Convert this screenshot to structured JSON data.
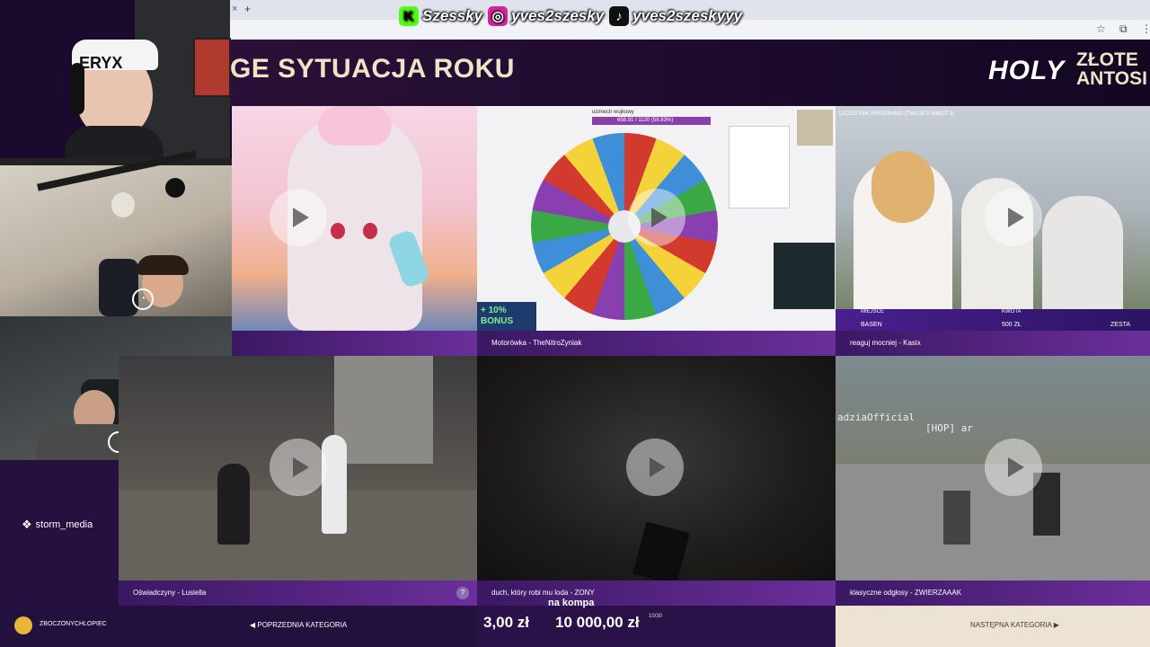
{
  "browser": {
    "tab_close": "×",
    "tab_new": "+",
    "star_icon": "☆",
    "ext_icon": "⧉",
    "menu_icon": "⋮"
  },
  "socials": [
    {
      "platform": "kick",
      "glyph": "K",
      "handle": "Szessky",
      "color": "#53fc18"
    },
    {
      "platform": "instagram",
      "glyph": "◎",
      "handle": "yves2szesky",
      "color": "#d6249f"
    },
    {
      "platform": "tiktok",
      "glyph": "♪",
      "handle": "yves2szeskyyy",
      "color": "#111111"
    }
  ],
  "header": {
    "title": "GE SYTUACJA ROKU",
    "logo_holy": "HOLY",
    "logo_line1": "ZŁOTE",
    "logo_line2": "ANTOSI"
  },
  "webcams": {
    "cam1_headband": "ERYX"
  },
  "sidebar": {
    "brand": "storm_media"
  },
  "tiles": [
    {
      "caption": "",
      "col": 1,
      "row": 1
    },
    {
      "caption": "Motorówka - TheNitroZyniak",
      "col": 2,
      "row": 1,
      "wheel_title": "uśmiech wujkowy",
      "wheel_progress": "658.91 / 1120 (58.83%)",
      "bonus": "+ 10% BONUS"
    },
    {
      "caption": "reaguj mocniej - Kasix",
      "col": 3,
      "row": 1,
      "top_label": "UCZESTNIK PROGRAMU (TWOJE 5 MINUT 3)",
      "lower_labels": [
        "MIEJSCE",
        "KWOTA",
        "BASEN",
        "500 ZŁ",
        "ZESTA"
      ]
    },
    {
      "caption": "Oświadczyny - Lusiella",
      "col": 1,
      "row": 2,
      "help": "?"
    },
    {
      "caption": "duch, który robi mu loda - ZONY",
      "col": 2,
      "row": 2
    },
    {
      "caption": "klasyczne odgłosy - ZWIERZAAAK",
      "col": 3,
      "row": 2,
      "mc_name": "adziaOfficial",
      "mc_tag": "[HOP] ar"
    }
  ],
  "bottom": {
    "user": "ZBOCZONYCHLOPIEC",
    "prev_label": "POPRZEDNIA KATEGORIA",
    "na_kompa": "na kompa",
    "price_from": "3,00 zł",
    "price_to": "10 000,00 zł",
    "counter": "10/30",
    "next_label": "NASTĘPNA KATEGORIA"
  }
}
